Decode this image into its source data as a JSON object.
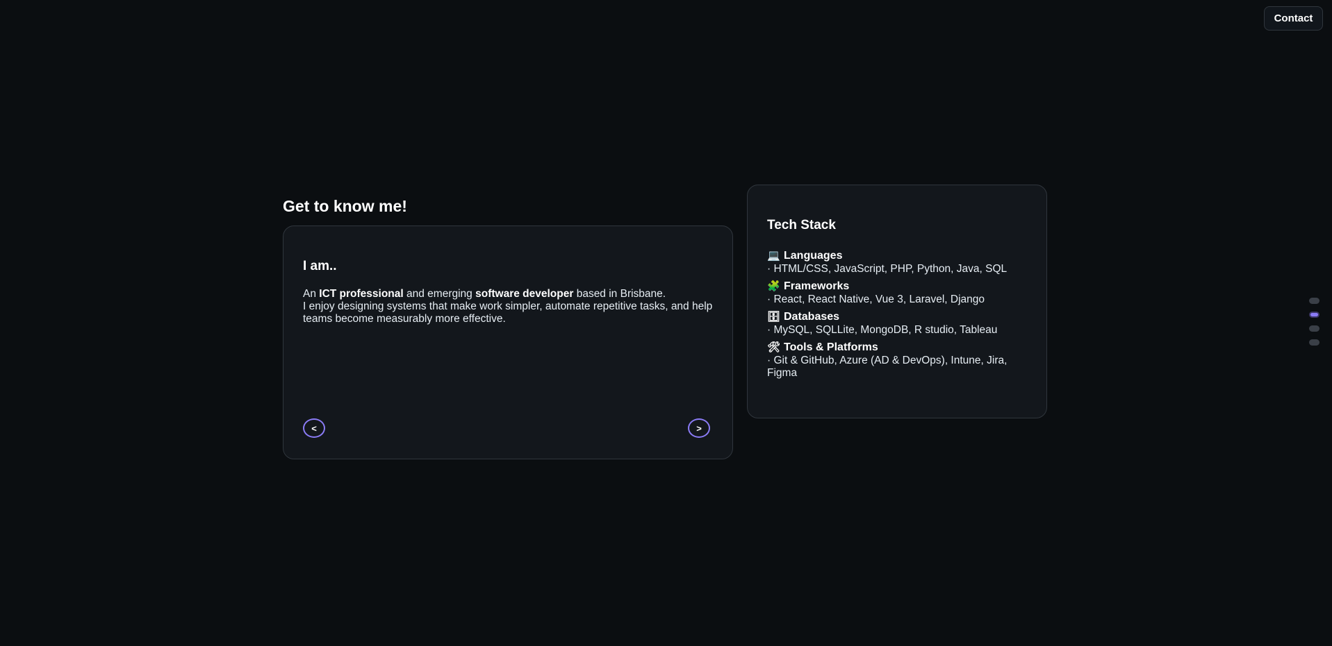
{
  "header": {
    "contact_label": "Contact"
  },
  "about": {
    "heading": "Get to know me!",
    "card_title": "I am..",
    "line1_prefix": "An ",
    "line1_bold1": "ICT professional",
    "line1_mid": " and emerging ",
    "line1_bold2": "software developer",
    "line1_suffix": " based in Brisbane.",
    "line2": "I enjoy designing systems that make work simpler, automate repetitive tasks, and help teams become measurably more effective.",
    "prev_label": "<",
    "next_label": ">"
  },
  "tech_stack": {
    "title": "Tech Stack",
    "groups": [
      {
        "icon": "💻",
        "icon_name": "laptop-icon",
        "label": "Languages",
        "items": "· HTML/CSS, JavaScript, PHP, Python, Java, SQL"
      },
      {
        "icon": "🧩",
        "icon_name": "puzzle-piece-icon",
        "label": "Frameworks",
        "items": "· React, React Native, Vue 3, Laravel, Django"
      },
      {
        "icon": "🗄",
        "icon_name": "file-cabinet-icon",
        "label": "Databases",
        "items": "· MySQL, SQLLite, MongoDB, R studio, Tableau"
      },
      {
        "icon": "🛠",
        "icon_name": "tools-icon",
        "label": "Tools & Platforms",
        "items": "· Git & GitHub, Azure (AD & DevOps), Intune, Jira, Figma"
      }
    ]
  },
  "section_nav": {
    "active_index": 1,
    "count": 4
  },
  "colors": {
    "background": "#0b0e11",
    "card": "#13171c",
    "border": "#30363d",
    "accent": "#8b7cf6"
  }
}
